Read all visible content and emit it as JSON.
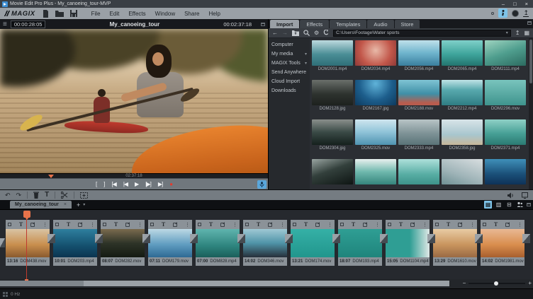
{
  "window": {
    "title": "Movie Edit Pro Plus - My_canoeing_tour-MVP",
    "controls": {
      "minimize": "–",
      "maximize": "□",
      "close": "×"
    }
  },
  "menubar": {
    "brand": "MAGIX",
    "items": [
      "File",
      "Edit",
      "Effects",
      "Window",
      "Share",
      "Help"
    ]
  },
  "icons": {
    "hamburger": "≡",
    "back": "←",
    "forward": "→",
    "settings": "⚙",
    "caret_down": "▾",
    "import_up": "↥",
    "undo": "↶",
    "redo": "↷",
    "title_tool": "T",
    "plus": "+",
    "close": "×",
    "menu_dots": "⋮",
    "grid_view": "▦",
    "list_view": "▥",
    "stack_view": "⊟",
    "upload": "↥"
  },
  "preview": {
    "current_time": "00:00:28:05",
    "title": "My_canoeing_tour",
    "total_time": "00:02:37:18",
    "scrub_time": "02:37:18",
    "transport": [
      {
        "name": "mark-in-button",
        "glyph": "["
      },
      {
        "name": "mark-out-button",
        "glyph": "]"
      },
      {
        "name": "jump-start-button",
        "glyph": "[◀"
      },
      {
        "name": "previous-frame-button",
        "glyph": "|◀"
      },
      {
        "name": "play-button",
        "glyph": "▶"
      },
      {
        "name": "play-range-button",
        "glyph": "[▶]"
      },
      {
        "name": "jump-end-button",
        "glyph": "▶]"
      },
      {
        "name": "record-button",
        "glyph": "●",
        "color": "#e23b30"
      }
    ]
  },
  "media_pool": {
    "tabs": [
      {
        "label": "Import",
        "active": true
      },
      {
        "label": "Effects",
        "active": false
      },
      {
        "label": "Templates",
        "active": false
      },
      {
        "label": "Audio",
        "active": false
      },
      {
        "label": "Store",
        "active": false
      }
    ],
    "path": "C:\\Users\\Footage\\Water sports",
    "tree": [
      {
        "label": "Computer",
        "caret": ""
      },
      {
        "label": "My media",
        "caret": "▾"
      },
      {
        "label": "MAGIX Tools",
        "caret": "▾"
      },
      {
        "label": "Send Anywhere",
        "caret": ""
      },
      {
        "label": "Cloud Import",
        "caret": ""
      },
      {
        "label": "Downloads",
        "caret": ""
      }
    ],
    "items": [
      {
        "name": "DOM2001.mp4",
        "bg": "linear-gradient(180deg,#bdd9de,#4a8e96 55%,#2f6f78)"
      },
      {
        "name": "DOM2034.mp4",
        "bg": "radial-gradient(circle at 50% 40%,#e8b9a8,#c2574a 60%,#8e3a38)"
      },
      {
        "name": "DOM2056.mp4",
        "bg": "linear-gradient(180deg,#bfe0ea,#6fb4cd 50%,#3a7f9e)"
      },
      {
        "name": "DOM2065.mp4",
        "bg": "linear-gradient(180deg,#7fd0c9,#3ea49b 55%,#23756f)"
      },
      {
        "name": "DOM2111.mp4",
        "bg": "linear-gradient(160deg,#9fd4c0,#4f9e8e 50%,#2c6b60)"
      },
      {
        "name": "DOM2128.jpg",
        "bg": "linear-gradient(180deg,#6a6f6a,#2e332f 55%,#1d211e)"
      },
      {
        "name": "DOM2167.jpg",
        "bg": "radial-gradient(circle at 50% 15%,#5fb3d9,#1d5e8c 55%,#0d3a5e)"
      },
      {
        "name": "DOM2188.mov",
        "bg": "linear-gradient(180deg,#7fc4d4,#3f8fa6 55%,#b85c4e 90%)"
      },
      {
        "name": "DOM2212.mp4",
        "bg": "linear-gradient(180deg,#bfe3e6,#57a8ad 40%,#2f7d83)"
      },
      {
        "name": "DOM2296.mov",
        "bg": "linear-gradient(180deg,#79c4bd,#3f948d)"
      },
      {
        "name": "DOM2304.jpg",
        "bg": "linear-gradient(180deg,#8a8f8c,#3a4a46 50%,#15201d)"
      },
      {
        "name": "DOM2325.mov",
        "bg": "linear-gradient(180deg,#cfe6ef,#8fc3d8 50%,#4f93b0)"
      },
      {
        "name": "DOM2333.mp4",
        "bg": "linear-gradient(180deg,#b8c4c6,#7e9296 55%,#5a7478)"
      },
      {
        "name": "DOM2358.jpg",
        "bg": "linear-gradient(180deg,#d8e4e8,#a8c6ce 60%,#c8b89a)"
      },
      {
        "name": "DOM2371.mp4",
        "bg": "linear-gradient(180deg,#8fd0c6,#47a096 55%,#2b7a72)"
      },
      {
        "name": "",
        "bg": "linear-gradient(160deg,#9aa5a2,#33403c 45%,#0e1513)"
      },
      {
        "name": "",
        "bg": "linear-gradient(180deg,#e8f0ee,#6fb8ad 50%,#35857c)"
      },
      {
        "name": "",
        "bg": "linear-gradient(180deg,#aee0da,#58ada4 60%,#3d938a)"
      },
      {
        "name": "",
        "bg": "linear-gradient(200deg,#d8dee0,#9fb4b8 60%,#6f9094)"
      },
      {
        "name": "",
        "bg": "linear-gradient(180deg,#3f8fb8,#1a4f78 60%,#0e3258)"
      }
    ]
  },
  "timeline": {
    "tab_label": "My_canoeing_tour",
    "clip_icons": {
      "title": "T",
      "menu": "⋮"
    },
    "clips": [
      {
        "duration": "13:16",
        "name": "DOM438.mov",
        "bg": "linear-gradient(180deg,#d8c3a4,#c98f4e 55%,#8a5a2e)"
      },
      {
        "duration": "10:01",
        "name": "DOM203.mp4",
        "bg": "linear-gradient(180deg,#2e7f9e,#14506e 60%,#0b3450)"
      },
      {
        "duration": "08:07",
        "name": "DOM282.mov",
        "bg": "linear-gradient(180deg,#7a6a4e,#2e3428 50%,#141a12)"
      },
      {
        "duration": "07:11",
        "name": "DOM179.mov",
        "bg": "linear-gradient(180deg,#bcd8e4,#5f9cc0 55%,#2e6a94)"
      },
      {
        "duration": "07:00",
        "name": "DOM828.mp4",
        "bg": "linear-gradient(180deg,#5fb4ae,#2e847e 60%,#1a5f5a)"
      },
      {
        "duration": "14:02",
        "name": "DOM346.mov",
        "bg": "linear-gradient(180deg,#9fc8d4,#4f94a8 50%,#26303a)"
      },
      {
        "duration": "13:21",
        "name": "DOM174.mov",
        "bg": "linear-gradient(180deg,#35b0a6,#21968d)"
      },
      {
        "duration": "18:07",
        "name": "DOM193.mp4",
        "bg": "linear-gradient(180deg,#2f9e94,#1f857c)"
      },
      {
        "duration": "15:05",
        "name": "DOM1104.mp4",
        "bg": "linear-gradient(90deg,#2f9e94 55%,#dfe8e6)"
      },
      {
        "duration": "13:29",
        "name": "DOM1610.mov",
        "bg": "linear-gradient(180deg,#e8cba4,#c9955e 55%,#9a6a44)"
      },
      {
        "duration": "14:02",
        "name": "DOM1981.mov",
        "bg": "linear-gradient(180deg,#e8b894,#d98e4e 55%,#a85f2e)"
      }
    ]
  },
  "bottom": {
    "zoom_out": "−",
    "zoom_in": "+",
    "status_text": "0 Hz"
  },
  "colors": {
    "accent_blue": "#7ec3e8",
    "record_red": "#e23b30",
    "playhead_orange": "#e8734a"
  }
}
